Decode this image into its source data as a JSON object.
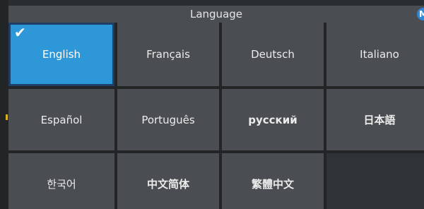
{
  "dialog": {
    "title": "Language",
    "mode_badge": "M"
  },
  "icons": {
    "selected_check": "✔"
  },
  "colors": {
    "selected_tile": "#2e97d8",
    "tile": "#4a4d51",
    "title_bar": "#4a4d51",
    "badge": "#2f88d6"
  },
  "languages": [
    {
      "label": "English",
      "selected": true
    },
    {
      "label": "Français",
      "selected": false
    },
    {
      "label": "Deutsch",
      "selected": false
    },
    {
      "label": "Italiano",
      "selected": false
    },
    {
      "label": "Español",
      "selected": false
    },
    {
      "label": "Português",
      "selected": false
    },
    {
      "label": "русский",
      "selected": false
    },
    {
      "label": "日本語",
      "selected": false
    },
    {
      "label": "한국어",
      "selected": false
    },
    {
      "label": "中文简体",
      "selected": false
    },
    {
      "label": "繁體中文",
      "selected": false
    }
  ]
}
